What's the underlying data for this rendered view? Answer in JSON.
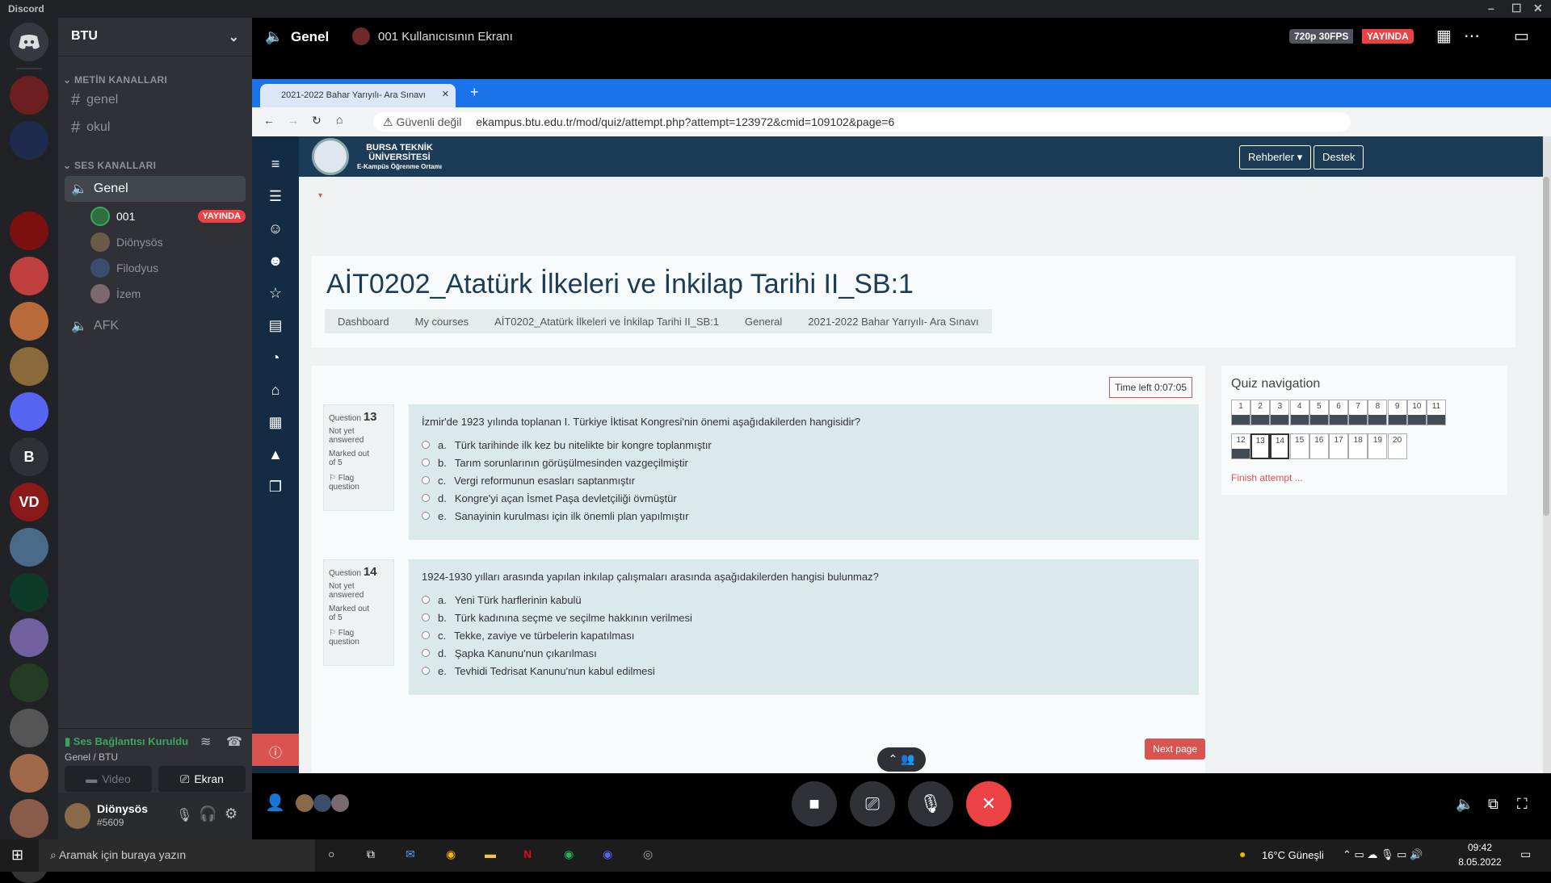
{
  "app": {
    "title": "Discord"
  },
  "guild": {
    "name": "BTU"
  },
  "categories": {
    "text": "METİN KANALLARI",
    "voice": "SES KANALLARI"
  },
  "text_channels": [
    "genel",
    "okul"
  ],
  "voice_channels": {
    "general": "Genel",
    "afk": "AFK"
  },
  "voice_users": [
    {
      "name": "001",
      "badge": "YAYINDA"
    },
    {
      "name": "Diönysös"
    },
    {
      "name": "Filodyus"
    },
    {
      "name": "İzem"
    }
  ],
  "voice_connection": {
    "status": "Ses Bağlantısı Kuruldu",
    "location": "Genel / BTU",
    "video": "Video",
    "screen": "Ekran"
  },
  "current_user": {
    "name": "Diönysös",
    "tag": "#5609"
  },
  "stream_header": {
    "channel": "Genel",
    "stream_title": "001 Kullanıcısının Ekranı",
    "quality": "720p 30FPS",
    "live": "YAYINDA"
  },
  "server_icons": [
    {
      "label": ""
    },
    {
      "label": ""
    },
    {
      "label": ""
    },
    {
      "label": ""
    },
    {
      "label": ""
    },
    {
      "label": ""
    },
    {
      "label": ""
    },
    {
      "label": ""
    },
    {
      "label": "B"
    },
    {
      "label": "VD"
    },
    {
      "label": ""
    },
    {
      "label": ""
    },
    {
      "label": ""
    },
    {
      "label": ""
    },
    {
      "label": ""
    },
    {
      "label": ""
    },
    {
      "label": ""
    },
    {
      "label": ""
    }
  ],
  "browser": {
    "tab_title": "2021-2022 Bahar Yarıyılı- Ara Sınavı",
    "security": "Güvenli değil",
    "url": "ekampus.btu.edu.tr/mod/quiz/attempt.php?attempt=123972&cmid=109102&page=6"
  },
  "site": {
    "logo_line1": "BURSA TEKNİK",
    "logo_line2": "ÜNİVERSİTESİ",
    "logo_line3": "E-Kampüs Öğrenme Ortamı",
    "btn_guides": "Rehberler ▾",
    "btn_support": "Destek",
    "course_title": "AİT0202_Atatürk İlkeleri ve İnkilap Tarihi II_SB:1",
    "breadcrumb": [
      "Dashboard",
      "My courses",
      "AİT0202_Atatürk İlkeleri ve İnkilap Tarihi II_SB:1",
      "General",
      "2021-2022 Bahar Yarıyılı- Ara Sınavı"
    ],
    "time_left": "Time left 0:07:05",
    "questions": [
      {
        "label": "Question",
        "number": "13",
        "state": "Not yet answered",
        "marks": "Marked out of 5",
        "flag": "Flag question",
        "text": "İzmir'de 1923 yılında toplanan I. Türkiye İktisat Kongresi'nin önemi aşağıdakilerden hangisidir?",
        "options": [
          {
            "k": "a.",
            "t": "Türk tarihinde ilk kez bu nitelikte bir kongre toplanmıştır"
          },
          {
            "k": "b.",
            "t": "Tarım sorunlarının görüşülmesinden vazgeçilmiştir"
          },
          {
            "k": "c.",
            "t": "Vergi reformunun esasları saptanmıştır"
          },
          {
            "k": "d.",
            "t": "Kongre'yi açan İsmet Paşa devletçiliği övmüştür"
          },
          {
            "k": "e.",
            "t": "Sanayinin kurulması için ilk önemli plan yapılmıştır"
          }
        ]
      },
      {
        "label": "Question",
        "number": "14",
        "state": "Not yet answered",
        "marks": "Marked out of 5",
        "flag": "Flag question",
        "text": "1924-1930 yılları arasında yapılan inkılap çalışmaları arasında aşağıdakilerden hangisi bulunmaz?",
        "options": [
          {
            "k": "a.",
            "t": "Yeni Türk harflerinin kabulü"
          },
          {
            "k": "b.",
            "t": "Türk kadınına seçme ve seçilme hakkının verilmesi"
          },
          {
            "k": "c.",
            "t": "Tekke, zaviye ve türbelerin kapatılması"
          },
          {
            "k": "d.",
            "t": "Şapka Kanunu'nun çıkarılması"
          },
          {
            "k": "e.",
            "t": "Tevhidi Tedrisat Kanunu'nun kabul edilmesi"
          }
        ]
      }
    ],
    "quiz_nav": {
      "title": "Quiz navigation",
      "items": [
        "1",
        "2",
        "3",
        "4",
        "5",
        "6",
        "7",
        "8",
        "9",
        "10",
        "11",
        "12",
        "13",
        "14",
        "15",
        "16",
        "17",
        "18",
        "19",
        "20"
      ],
      "finish": "Finish attempt ..."
    },
    "next_page": "Next page"
  },
  "taskbar": {
    "search": "Aramak için buraya yazın",
    "weather": "16°C Güneşli",
    "time": "09:42",
    "date": "8.05.2022"
  }
}
